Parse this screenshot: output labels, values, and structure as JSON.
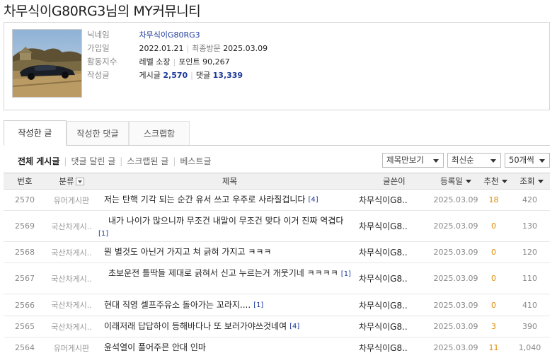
{
  "page": {
    "title": "차무식이G80RG3님의 MY커뮤니티"
  },
  "profile": {
    "labels": {
      "nickname": "닉네임",
      "joined": "가입일",
      "activity": "활동지수",
      "posts": "작성글"
    },
    "nickname": "차무식이G80RG3",
    "joined": "2022.01.21",
    "last_visit_label": "최종방문",
    "last_visit": "2025.03.09",
    "level_label": "레벨",
    "level": "소장",
    "points_label": "포인트",
    "points": "90,267",
    "posts_label": "게시글",
    "posts": "2,570",
    "comments_label": "댓글",
    "comments": "13,339"
  },
  "tabs": [
    "작성한 글",
    "작성한 댓글",
    "스크랩함"
  ],
  "subnav": [
    "전체 게시글",
    "댓글 달린 글",
    "스크랩된 글",
    "베스트글"
  ],
  "selects": {
    "view": "제목만보기",
    "sort": "최신순",
    "count": "50개씩"
  },
  "table": {
    "headers": {
      "num": "번호",
      "cat": "분류",
      "title": "제목",
      "writer": "글쓴이",
      "date": "등록일",
      "rec": "추천",
      "view": "조회"
    },
    "rows": [
      {
        "num": "2570",
        "cat": "유머게시판",
        "title": "저는 탄핵 기각 되는 순간 유서 쓰고 우주로 사라질겁니다",
        "cmt": "[4]",
        "writer": "차무식이G8..",
        "date": "2025.03.09",
        "rec": "18",
        "view": "420"
      },
      {
        "num": "2569",
        "cat": "국산차게시..",
        "title": "내가 나이가 많으니까 무조건 내말이 무조건 맞다 이거 진짜 역겹다",
        "cmt": "[1]",
        "writer": "차무식이G8..",
        "date": "2025.03.09",
        "rec": "0",
        "view": "130"
      },
      {
        "num": "2568",
        "cat": "국산차게시..",
        "title": "뭔 별것도 아닌거 가지고 쳐 긁혀 가지고 ㅋㅋㅋ",
        "cmt": "",
        "writer": "차무식이G8..",
        "date": "2025.03.09",
        "rec": "0",
        "view": "120"
      },
      {
        "num": "2567",
        "cat": "국산차게시..",
        "title": "초보운전 틀딱들 제대로 긁혀서 신고 누르는거 개웃기네 ㅋㅋㅋㅋ",
        "cmt": "[1]",
        "writer": "차무식이G8..",
        "date": "2025.03.09",
        "rec": "0",
        "view": "110"
      },
      {
        "num": "2566",
        "cat": "국산차게시..",
        "title": "현대 직영 셀프주유소 돌아가는 꼬라지....",
        "cmt": "[1]",
        "writer": "차무식이G8..",
        "date": "2025.03.09",
        "rec": "0",
        "view": "410"
      },
      {
        "num": "2565",
        "cat": "국산차게시..",
        "title": "이래저래 답답하이 등해바다나 또 보러가야쓰것네여",
        "cmt": "[4]",
        "writer": "차무식이G8..",
        "date": "2025.03.09",
        "rec": "3",
        "view": "390"
      },
      {
        "num": "2564",
        "cat": "유머게시판",
        "title": "윤석열이 풀어주믄 안대 인마",
        "cmt": "",
        "writer": "차무식이G8..",
        "date": "2025.03.09",
        "rec": "11",
        "view": "1,040"
      }
    ]
  }
}
